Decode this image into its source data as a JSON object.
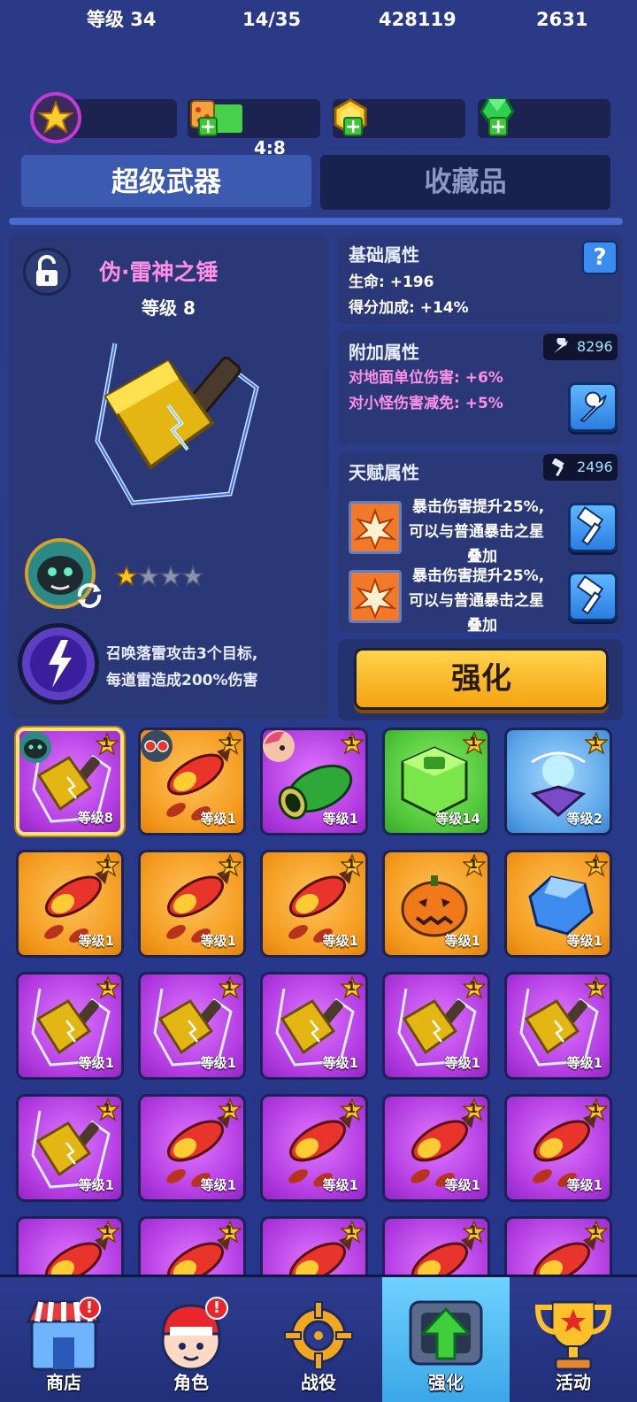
{
  "topbar": {
    "player_level": "等级 34",
    "energy": "14/35",
    "energy_timer": "4:8",
    "coins": "428119",
    "gems": "2631"
  },
  "tabs": [
    {
      "label": "超级武器",
      "active": true
    },
    {
      "label": "收藏品",
      "active": false
    }
  ],
  "weapon": {
    "name": "伪·雷神之锤",
    "level": "等级 8",
    "stars_filled": 1,
    "stars_total": 4,
    "skill_line1": "召唤落雷攻击3个目标,",
    "skill_line2": "每道雷造成200%伤害"
  },
  "base_attrs": {
    "title": "基础属性",
    "hp": "生命: +196",
    "score": "得分加成: +14%"
  },
  "extra_attrs": {
    "title": "附加属性",
    "cost": "8296",
    "line1": "对地面单位伤害: +6%",
    "line2": "对小怪伤害减免: +5%"
  },
  "talent_attrs": {
    "title": "天赋属性",
    "cost": "2496",
    "talents": [
      {
        "l1": "暴击伤害提升25%,",
        "l2": "可以与普通暴击之星",
        "l3": "叠加"
      },
      {
        "l1": "暴击伤害提升25%,",
        "l2": "可以与普通暴击之星",
        "l3": "叠加"
      }
    ]
  },
  "enhance_button": "强化",
  "grid": [
    {
      "level": "等级8",
      "color": "purple",
      "item": "hammer",
      "star": "1",
      "avatar": "panther"
    },
    {
      "level": "等级1",
      "color": "orange",
      "item": "rocket",
      "star": "1",
      "avatar": "robot"
    },
    {
      "level": "等级1",
      "color": "purple",
      "item": "cannon",
      "star": "1",
      "avatar": "girl"
    },
    {
      "level": "等级14",
      "color": "green",
      "item": "cube",
      "star": "1"
    },
    {
      "level": "等级2",
      "color": "blue",
      "item": "crystal",
      "star": "1"
    },
    {
      "level": "等级1",
      "color": "orange",
      "item": "rocket",
      "star": "1"
    },
    {
      "level": "等级1",
      "color": "orange",
      "item": "rocket",
      "star": "1"
    },
    {
      "level": "等级1",
      "color": "orange",
      "item": "rocket",
      "star": "1"
    },
    {
      "level": "等级1",
      "color": "orange",
      "item": "pumpkin",
      "star": "1"
    },
    {
      "level": "等级1",
      "color": "orange",
      "item": "ice",
      "star": "1"
    },
    {
      "level": "等级1",
      "color": "purple",
      "item": "hammer",
      "star": "1"
    },
    {
      "level": "等级1",
      "color": "purple",
      "item": "hammer",
      "star": "1"
    },
    {
      "level": "等级1",
      "color": "purple",
      "item": "hammer",
      "star": "1"
    },
    {
      "level": "等级1",
      "color": "purple",
      "item": "hammer",
      "star": "1"
    },
    {
      "level": "等级1",
      "color": "purple",
      "item": "hammer",
      "star": "1"
    },
    {
      "level": "等级1",
      "color": "purple",
      "item": "hammer",
      "star": "1"
    },
    {
      "level": "等级1",
      "color": "purple",
      "item": "rocket",
      "star": "1"
    },
    {
      "level": "等级1",
      "color": "purple",
      "item": "rocket",
      "star": "1"
    },
    {
      "level": "等级1",
      "color": "purple",
      "item": "rocket",
      "star": "1"
    },
    {
      "level": "等级1",
      "color": "purple",
      "item": "rocket",
      "star": "1"
    },
    {
      "level": "",
      "color": "purple",
      "item": "rocket",
      "star": "1"
    },
    {
      "level": "",
      "color": "purple",
      "item": "rocket",
      "star": "1"
    },
    {
      "level": "",
      "color": "purple",
      "item": "rocket",
      "star": "1"
    },
    {
      "level": "",
      "color": "purple",
      "item": "rocket",
      "star": "1"
    },
    {
      "level": "",
      "color": "purple",
      "item": "rocket",
      "star": "1"
    }
  ],
  "nav": [
    {
      "label": "商店",
      "icon": "shop-icon",
      "alert": "!"
    },
    {
      "label": "角色",
      "icon": "character-icon",
      "alert": "!"
    },
    {
      "label": "战役",
      "icon": "campaign-icon"
    },
    {
      "label": "强化",
      "icon": "enhance-icon",
      "active": true
    },
    {
      "label": "活动",
      "icon": "trophy-icon"
    }
  ]
}
